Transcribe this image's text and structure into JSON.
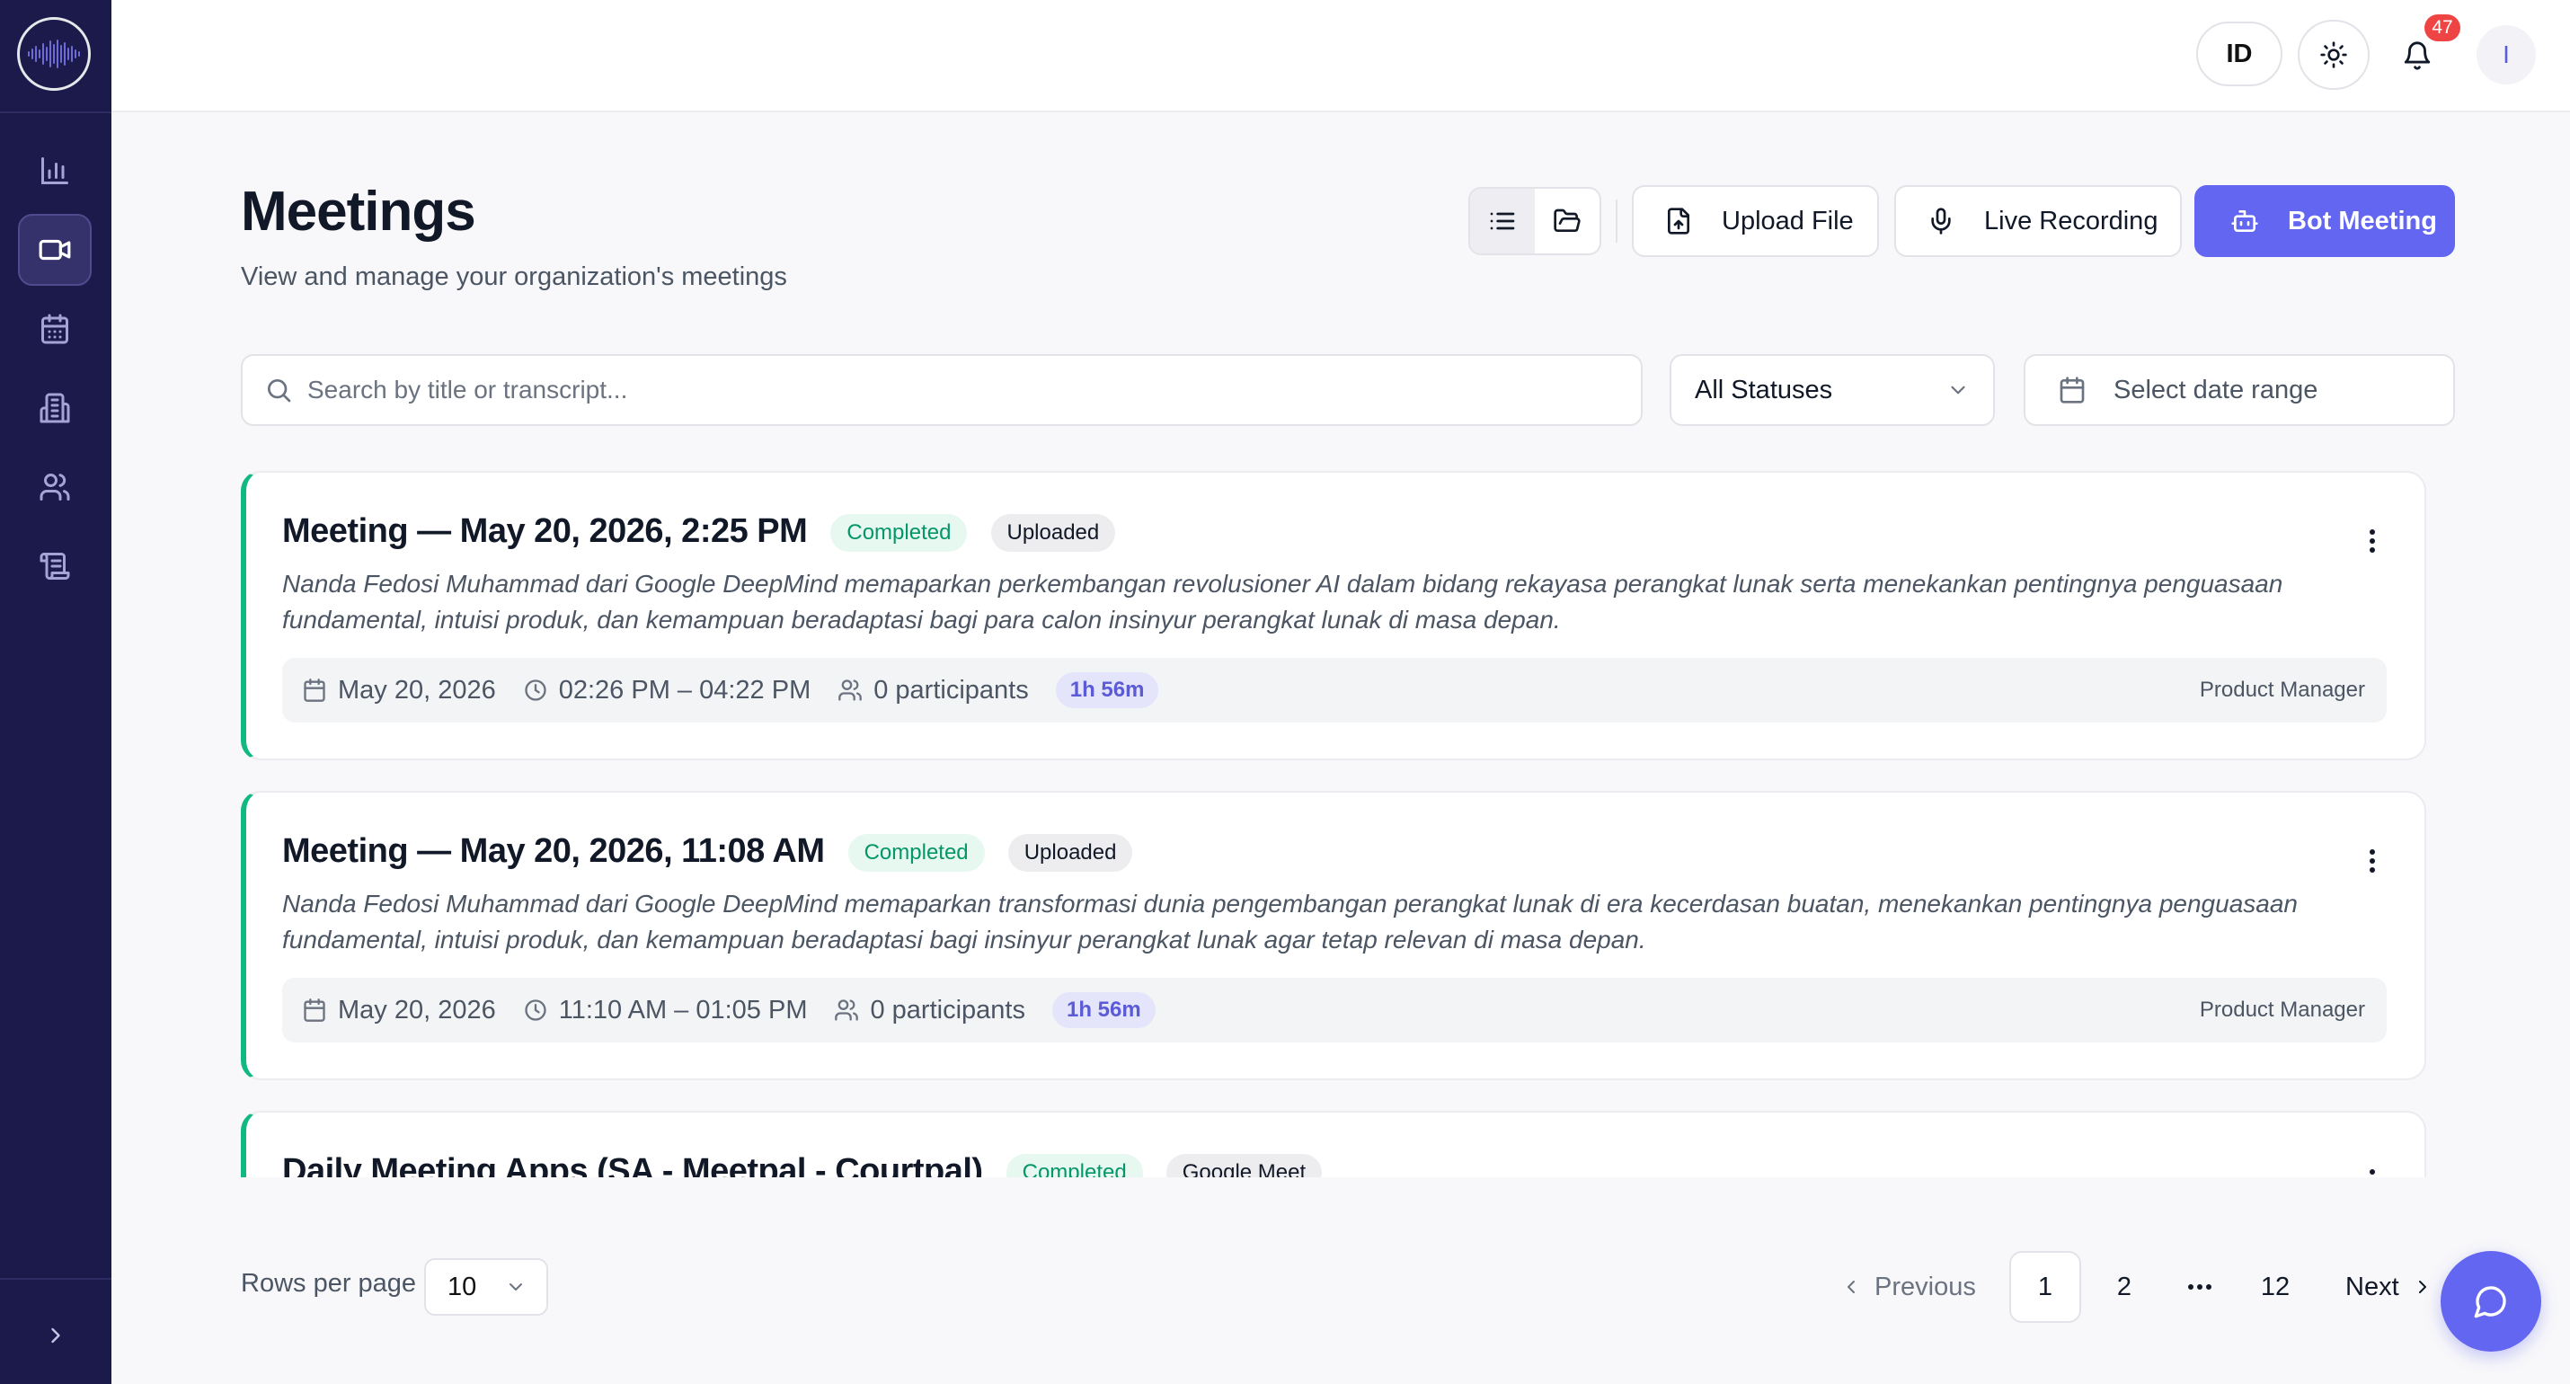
{
  "header": {
    "language": "ID",
    "notification_count": "47",
    "avatar_initial": "I"
  },
  "page": {
    "title": "Meetings",
    "subtitle": "View and manage your organization's meetings"
  },
  "toolbar": {
    "upload_label": "Upload File",
    "live_label": "Live Recording",
    "bot_label": "Bot Meeting"
  },
  "filters": {
    "search_placeholder": "Search by title or transcript...",
    "status_value": "All Statuses",
    "date_placeholder": "Select date range"
  },
  "meetings": [
    {
      "title": "Meeting — May 20, 2026, 2:25 PM",
      "status": "Completed",
      "source": "Uploaded",
      "description": "Nanda Fedosi Muhammad dari Google DeepMind memaparkan perkembangan revolusioner AI dalam bidang rekayasa perangkat lunak serta menekankan pentingnya penguasaan fundamental, intuisi produk, dan kemampuan beradaptasi bagi para calon insinyur perangkat lunak di masa depan.",
      "date": "May 20, 2026",
      "time": "02:26 PM – 04:22 PM",
      "participants": "0 participants",
      "duration": "1h 56m",
      "role": "Product Manager"
    },
    {
      "title": "Meeting — May 20, 2026, 11:08 AM",
      "status": "Completed",
      "source": "Uploaded",
      "description": "Nanda Fedosi Muhammad dari Google DeepMind memaparkan transformasi dunia pengembangan perangkat lunak di era kecerdasan buatan, menekankan pentingnya penguasaan fundamental, intuisi produk, dan kemampuan beradaptasi bagi insinyur perangkat lunak agar tetap relevan di masa depan.",
      "date": "May 20, 2026",
      "time": "11:10 AM – 01:05 PM",
      "participants": "0 participants",
      "duration": "1h 56m",
      "role": "Product Manager"
    },
    {
      "title": "Daily Meeting Apps (SA - Meetpal - Courtpal)",
      "status": "Completed",
      "source": "Google Meet"
    }
  ],
  "pagination": {
    "rows_label": "Rows per page",
    "rows_value": "10",
    "prev_label": "Previous",
    "next_label": "Next",
    "pages": [
      "1",
      "2",
      "12"
    ],
    "current_page": "1"
  },
  "colors": {
    "sidebar_bg": "#1c1a4a",
    "accent": "#6366f1",
    "completed": "#059669",
    "card_stripe": "#10b981"
  }
}
